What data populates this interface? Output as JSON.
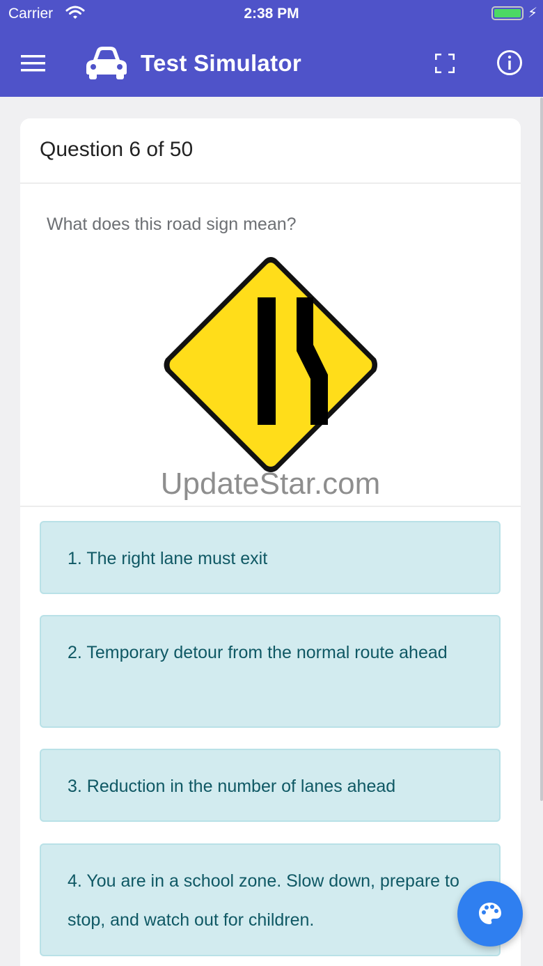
{
  "status_bar": {
    "carrier": "Carrier",
    "time": "2:38 PM"
  },
  "header": {
    "title": "Test Simulator"
  },
  "question": {
    "counter": "Question 6 of 50",
    "text": "What does this road sign mean?",
    "watermark": "UpdateStar.com"
  },
  "answers": [
    {
      "label": "1. The right lane must exit"
    },
    {
      "label": "2. Temporary detour from the normal route ahead"
    },
    {
      "label": "3. Reduction in the number of lanes ahead"
    },
    {
      "label": "4. You are in a school zone. Slow down, prepare to stop, and watch out for children."
    }
  ],
  "icons": {
    "menu": "hamburger-menu-icon",
    "logo": "car-icon",
    "fullscreen": "fullscreen-icon",
    "info": "info-icon",
    "fab": "palette-icon",
    "wifi": "wifi-icon",
    "battery": "battery-icon"
  },
  "colors": {
    "appbar": "#4f53c9",
    "answer_bg": "#d2ebef",
    "answer_text": "#0f5864",
    "fab": "#2f7ff0",
    "sign_yellow": "#ffdd1a"
  }
}
